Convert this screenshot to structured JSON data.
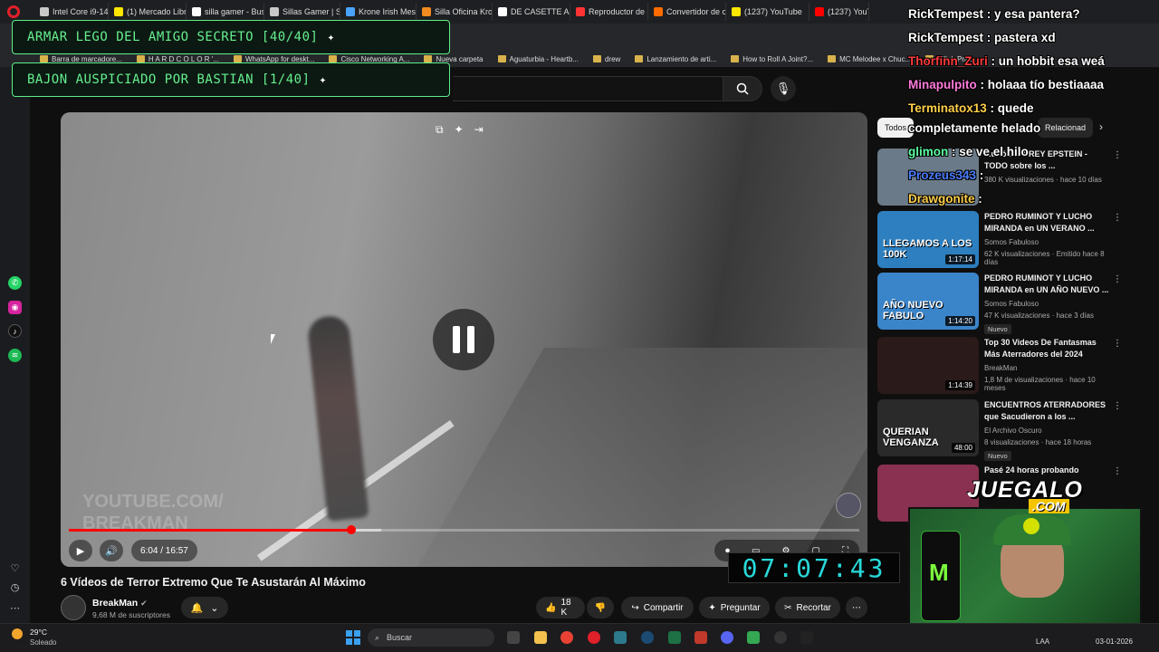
{
  "browser": {
    "tabs": [
      "Intel Core i9-1490",
      "(1) Mercado Libre",
      "silla gamer - Busca",
      "Sillas Gamer | Sold",
      "Krone Irish Mesh |",
      "Silla Oficina Krone",
      "DE CASETTE A MP",
      "Reproductor de ca",
      "Convertidor de cir",
      "(1237) YouTube",
      "(1237) YouTu"
    ],
    "tab_colors": [
      "#c8c8c8",
      "#ffe600",
      "#ffffff",
      "#c8c8c8",
      "#4aa3ff",
      "#f28b20",
      "#ffffff",
      "#ff3333",
      "#ff6a00",
      "#ffe600",
      "#ff0000"
    ],
    "bookmarks": [
      "Barra de marcadore...",
      "H A R D C O L O R '...",
      "WhatsApp for deskt...",
      "Cisco Networking A...",
      "Nueva carpeta",
      "Aguaturbia - Heartb...",
      "drew",
      "Lanzamiento de arti...",
      "How to Roll A Joint?...",
      "MC Melodee x Chuc...",
      "Killah Pries..."
    ]
  },
  "goals": [
    {
      "label": "ARMAR LEGO DEL AMIGO SECRETO [40/40]"
    },
    {
      "label": "BAJON AUSPICIADO POR BASTIAN [1/40]"
    }
  ],
  "player": {
    "watermark_line1": "YOUTUBE.COM/",
    "watermark_line2": "BREAKMAN",
    "time": "6:04 / 16:57",
    "progress_fraction": 0.357
  },
  "video": {
    "title": "6 Vídeos de Terror Extremo Que Te Asustarán Al Máximo",
    "channel": "BreakMan",
    "subscribers": "9,68 M de suscriptores",
    "likes": "18 K",
    "share_label": "Compartir",
    "ask_label": "Preguntar",
    "clip_label": "Recortar"
  },
  "chips": [
    "Todos",
    "Relacionad"
  ],
  "recommendations": [
    {
      "title": "...urió JEFFREY EPSTEIN - TODO sobre los ...",
      "channel": "",
      "views": "380 K visualizaciones · hace 10 días",
      "duration": "",
      "badge": "",
      "thumb_color": "#6b7a88"
    },
    {
      "title": "PEDRO RUMINOT Y LUCHO MIRANDA en UN VERANO ...",
      "channel": "Somos Fabuloso",
      "views": "62 K visualizaciones · Emitido hace 8 días",
      "duration": "1:17:14",
      "badge": "",
      "thumb_color": "#2d7fbf",
      "thumb_text": "LLEGAMOS A LOS 100K"
    },
    {
      "title": "PEDRO RUMINOT Y LUCHO MIRANDA en UN AÑO NUEVO ...",
      "channel": "Somos Fabuloso",
      "views": "47 K visualizaciones · hace 3 días",
      "duration": "1:14:20",
      "badge": "Nuevo",
      "thumb_color": "#3a84c9",
      "thumb_text": "AÑO NUEVO FABULO"
    },
    {
      "title": "Top 30 Videos De Fantasmas Más Aterradores del 2024",
      "channel": "BreakMan",
      "views": "1,8 M de visualizaciones · hace 10 meses",
      "duration": "1:14:39",
      "badge": "",
      "thumb_color": "#2a1a1a"
    },
    {
      "title": "ENCUENTROS ATERRADORES que Sacudieron a los ...",
      "channel": "El Archivo Oscuro",
      "views": "8 visualizaciones · hace 18 horas",
      "duration": "48:00",
      "badge": "Nuevo",
      "thumb_color": "#2a2a2a",
      "thumb_text": "QUERIAN VENGANZA"
    },
    {
      "title": "Pasé 24 horas probando",
      "channel": "",
      "views": "",
      "duration": "",
      "badge": "",
      "thumb_color": "#8a3050"
    }
  ],
  "chat": [
    {
      "user": "RickTempest",
      "msg": " : y esa pantera?",
      "color": "#ffffff"
    },
    {
      "user": "RickTempest",
      "msg": " : pastera xd",
      "color": "#ffffff"
    },
    {
      "user": "Thorfinn_Zuri",
      "msg": " : un hobbit esa weá",
      "color": "#ff3b3b"
    },
    {
      "user": "Minapulpito",
      "msg": " : holaaa tío bestiaaaa",
      "color": "#ff7ad9"
    },
    {
      "user": "Terminatox13",
      "msg": " : quede",
      "color": "#ffd04a"
    },
    {
      "user": "",
      "msg": "completamente helado",
      "color": "#ffffff"
    },
    {
      "user": "glimon",
      "msg": " : se ve el hilo",
      "color": "#5effa0"
    },
    {
      "user": "Prozeus343",
      "msg": " :",
      "color": "#4a7dff"
    },
    {
      "user": "Drawgonite",
      "msg": " :",
      "color": "#ffd04a"
    }
  ],
  "stream": {
    "logo_main": "JUEGALO",
    "logo_sub": ".COM",
    "timer": "07:07:43"
  },
  "taskbar": {
    "temp": "29°C",
    "weather": "Soleado",
    "search": "Buscar",
    "lang": "LAA",
    "date": "03-01-2026"
  }
}
